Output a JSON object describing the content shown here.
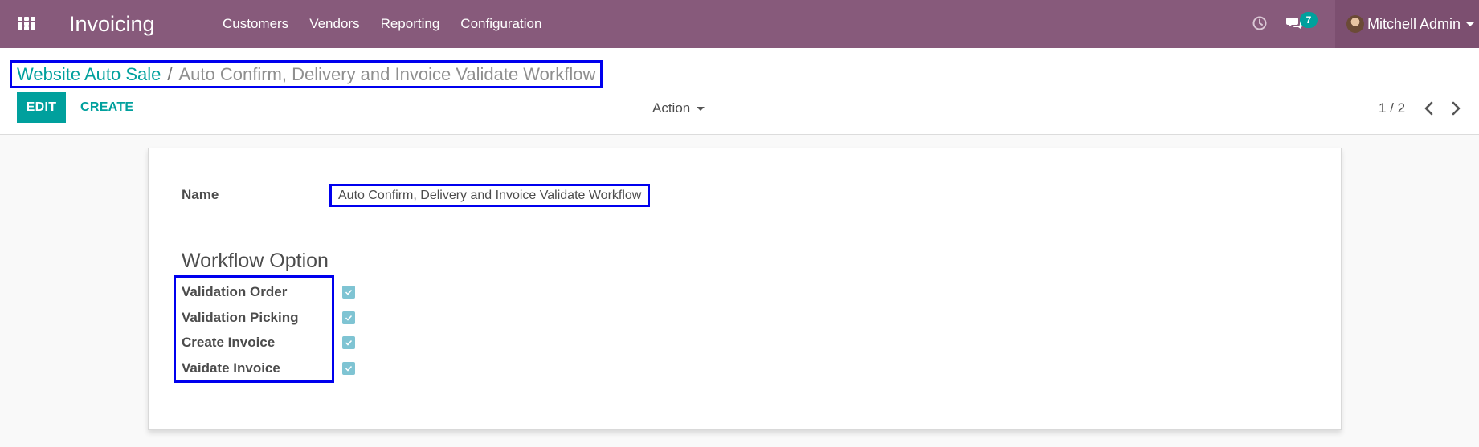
{
  "navbar": {
    "app_title": "Invoicing",
    "menu": [
      "Customers",
      "Vendors",
      "Reporting",
      "Configuration"
    ],
    "chat_count": "7",
    "user_name": "Mitchell Admin",
    "bg_color": "#875a7b"
  },
  "control_panel": {
    "breadcrumb": {
      "parent": "Website Auto Sale",
      "separator": "/",
      "current": "Auto Confirm, Delivery and Invoice Validate Workflow"
    },
    "edit_label": "EDIT",
    "create_label": "CREATE",
    "action_label": "Action",
    "pager": "1 / 2"
  },
  "form": {
    "name_label": "Name",
    "name_value": "Auto Confirm, Delivery and Invoice Validate Workflow",
    "section_title": "Workflow Option",
    "options": [
      {
        "label": "Validation Order",
        "checked": true
      },
      {
        "label": "Validation Picking",
        "checked": true
      },
      {
        "label": "Create Invoice",
        "checked": true
      },
      {
        "label": "Vaidate Invoice",
        "checked": true
      }
    ]
  },
  "colors": {
    "accent": "#00a09d",
    "checkbox": "#7fc4d3",
    "highlight": "#0000ee"
  }
}
